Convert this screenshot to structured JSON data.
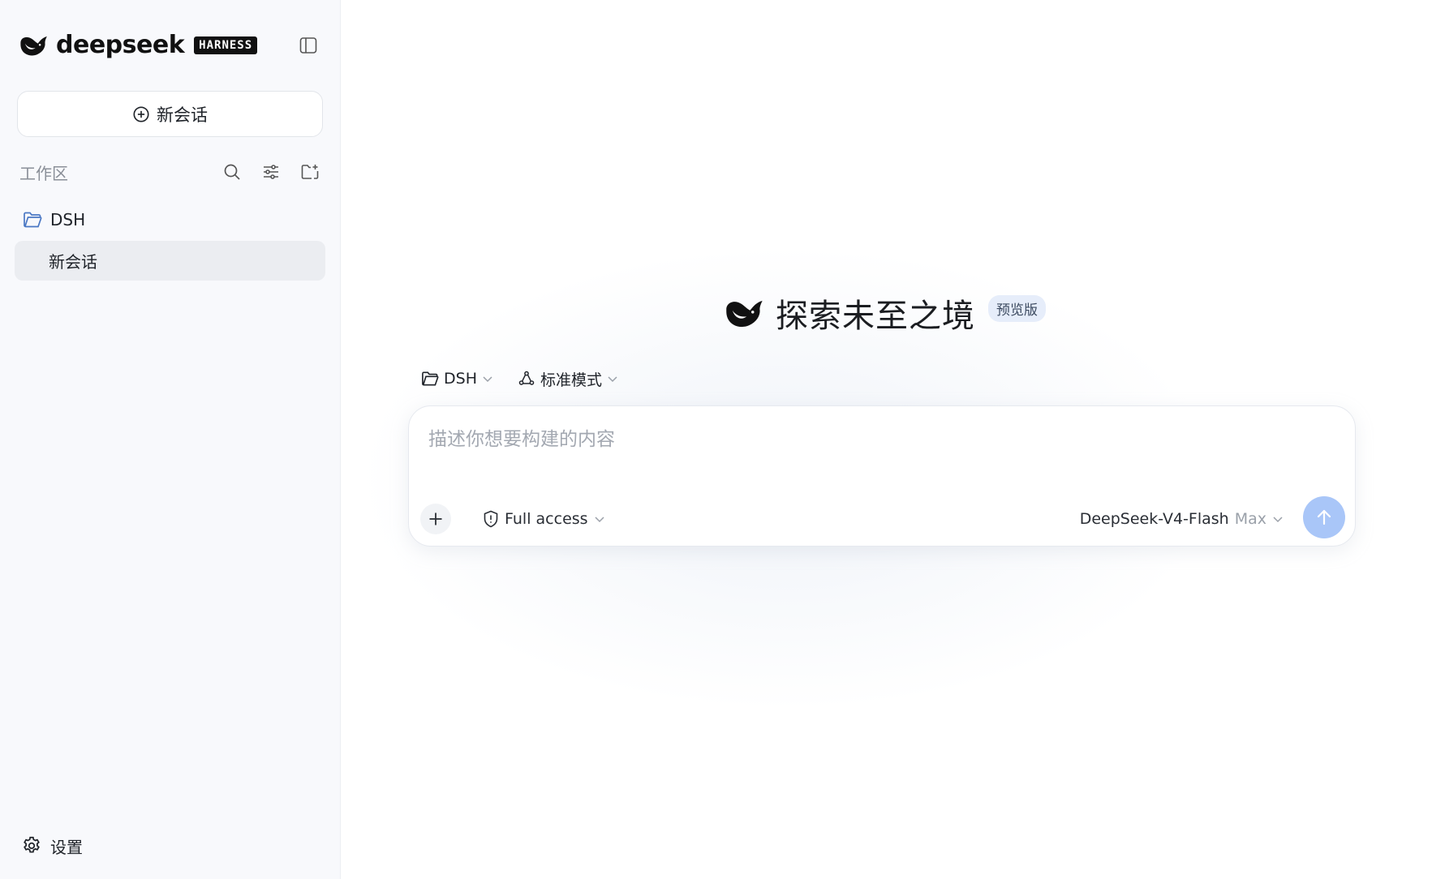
{
  "sidebar": {
    "brand": {
      "name": "deepseek",
      "badge": "HARNESS",
      "logo_icon": "whale-icon"
    },
    "collapse_icon": "sidebar-toggle-icon",
    "new_chat": {
      "label": "新会话",
      "icon": "plus-circle-icon"
    },
    "workspace": {
      "title": "工作区",
      "tools": [
        "search-icon",
        "filter-icon",
        "new-folder-icon"
      ]
    },
    "folders": [
      {
        "label": "DSH",
        "icon": "folder-icon",
        "chats": [
          {
            "label": "新会话",
            "selected": true
          }
        ]
      }
    ],
    "settings": {
      "label": "设置",
      "icon": "gear-icon"
    }
  },
  "main": {
    "hero": {
      "title": "探索未至之境",
      "badge": "预览版",
      "logo_icon": "whale-icon"
    },
    "selectors": {
      "workspace": "DSH",
      "mode": "标准模式"
    },
    "composer": {
      "placeholder": "描述你想要构建的内容",
      "value": "",
      "access": "Full access",
      "model": "DeepSeek-V4-Flash",
      "model_mode": "Max"
    }
  },
  "colors": {
    "sidebar_bg": "#f8f9fc",
    "selected_item_bg": "#ebedf1",
    "folder_icon": "#4a78c4",
    "send_button": "#a9c6f8",
    "preview_badge_bg": "#e6edfa"
  }
}
